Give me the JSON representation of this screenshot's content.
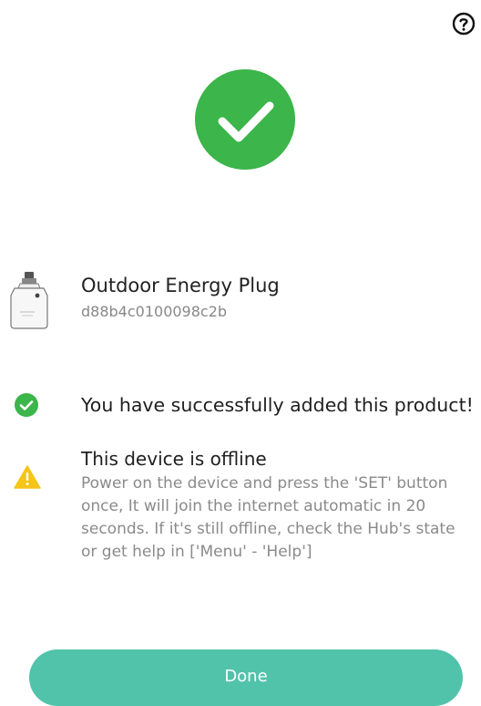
{
  "device": {
    "name": "Outdoor Energy Plug",
    "id": "d88b4c0100098c2b",
    "image": "smart-plug-icon"
  },
  "status": {
    "success_message": "You have successfully added this product!",
    "offline_title": "This device is offline",
    "offline_description": "Power on the device and press the 'SET' button once, It will join the internet automatic in 20 seconds. If it's still offline, check the Hub's state or get help in ['Menu' - 'Help']"
  },
  "actions": {
    "done_label": "Done"
  },
  "icons": {
    "help": "help-circle-icon",
    "success_large": "check-circle-icon",
    "success_small": "check-circle-icon",
    "warning": "warning-triangle-icon"
  },
  "colors": {
    "success_green": "#3cb54a",
    "accent_teal": "#52c3ab",
    "warning_yellow": "#f5c518"
  }
}
